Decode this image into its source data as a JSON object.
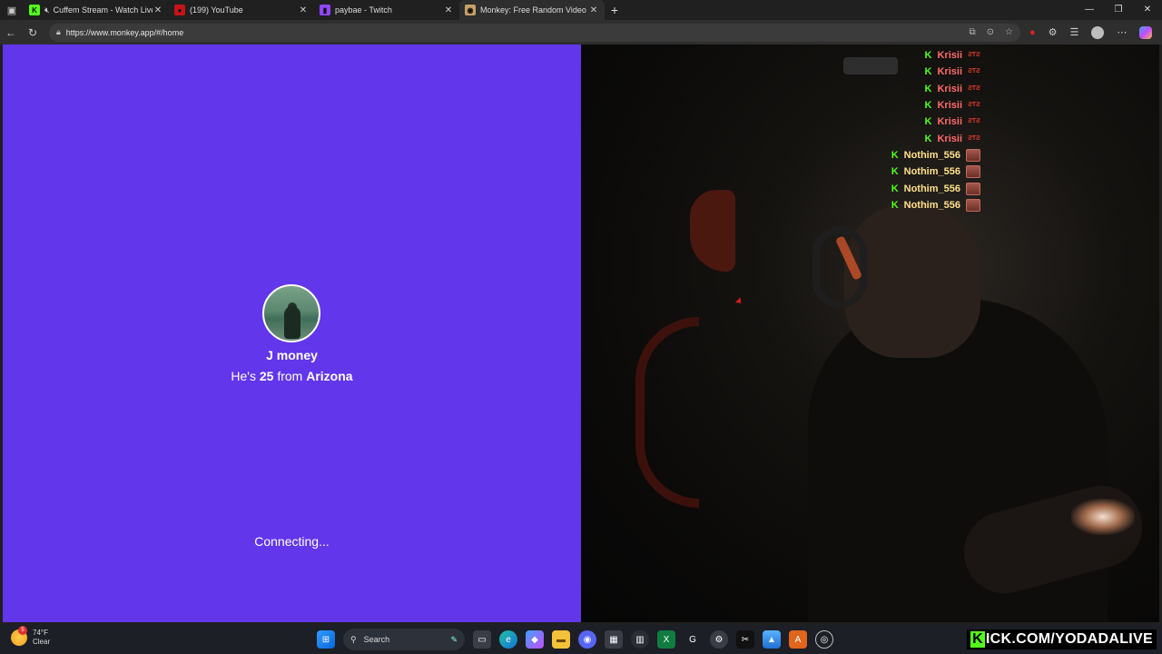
{
  "browser": {
    "tabs": [
      {
        "title": "Cuffem Stream - Watch Live",
        "favicon_color": "#53fc18",
        "favicon_glyph": "K",
        "muted": true,
        "active": false
      },
      {
        "title": "(199) YouTube",
        "favicon_color": "#c4141a",
        "favicon_glyph": "●",
        "muted": false,
        "active": false
      },
      {
        "title": "paybae - Twitch",
        "favicon_color": "#9146ff",
        "favicon_glyph": "▮",
        "muted": false,
        "active": false
      },
      {
        "title": "Monkey: Free Random Video Chat",
        "favicon_color": "#c8a06a",
        "favicon_glyph": "◉",
        "muted": false,
        "active": true
      }
    ],
    "url": "https://www.monkey.app/#/home"
  },
  "monkey": {
    "name": "J money",
    "info_prefix": "He's",
    "age": "25",
    "info_mid": "from",
    "location": "Arizona",
    "status": "Connecting..."
  },
  "chat": {
    "messages": [
      {
        "user": "Krisii",
        "color": "#ff6b6b",
        "emote": "krisii"
      },
      {
        "user": "Krisii",
        "color": "#ff6b6b",
        "emote": "krisii"
      },
      {
        "user": "Krisii",
        "color": "#ff6b6b",
        "emote": "krisii"
      },
      {
        "user": "Krisii",
        "color": "#ff6b6b",
        "emote": "krisii"
      },
      {
        "user": "Krisii",
        "color": "#ff6b6b",
        "emote": "krisii"
      },
      {
        "user": "Krisii",
        "color": "#ff6b6b",
        "emote": "krisii"
      },
      {
        "user": "Nothim_556",
        "color": "#ffe08a",
        "emote": "nothim"
      },
      {
        "user": "Nothim_556",
        "color": "#ffe08a",
        "emote": "nothim"
      },
      {
        "user": "Nothim_556",
        "color": "#ffe08a",
        "emote": "nothim"
      },
      {
        "user": "Nothim_556",
        "color": "#ffe08a",
        "emote": "nothim"
      }
    ]
  },
  "taskbar": {
    "temperature": "74°F",
    "condition": "Clear",
    "weather_badge": "5",
    "search_placeholder": "Search",
    "brand_k": "K",
    "brand_text": "ICK.COM/YODADALIVE"
  },
  "colors": {
    "panel": "#6236eb",
    "kick_green": "#53fc18"
  }
}
